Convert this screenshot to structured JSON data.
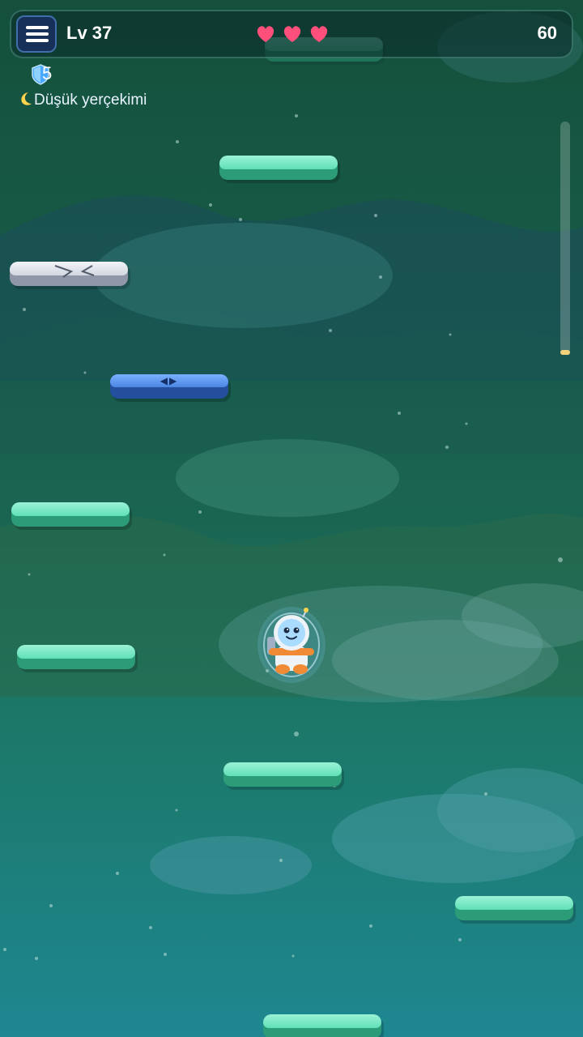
{
  "hud": {
    "menu_icon": "hamburger-menu-icon",
    "level": "Lv 37",
    "lives": 3,
    "lives_icon": "heart-icon",
    "score": "60"
  },
  "powerups": {
    "shield_icon": "shield-icon",
    "shield_count": "5",
    "status_icon": "crescent-moon-icon",
    "status_text": "Düşük yerçekimi"
  },
  "progress": {
    "fraction": 0.02
  },
  "player": {
    "character": "astronaut",
    "shielded": true
  },
  "platforms": [
    {
      "type": "normal"
    },
    {
      "type": "normal"
    },
    {
      "type": "cracked"
    },
    {
      "type": "moving"
    },
    {
      "type": "normal"
    },
    {
      "type": "normal"
    },
    {
      "type": "normal"
    },
    {
      "type": "normal"
    },
    {
      "type": "normal"
    }
  ],
  "colors": {
    "platform_normal": "#5fe0b7",
    "platform_moving": "#4b86e2",
    "platform_cracked": "#d2d7e1",
    "heart": "#ff4f7a",
    "shield": "#4aa8ff"
  }
}
